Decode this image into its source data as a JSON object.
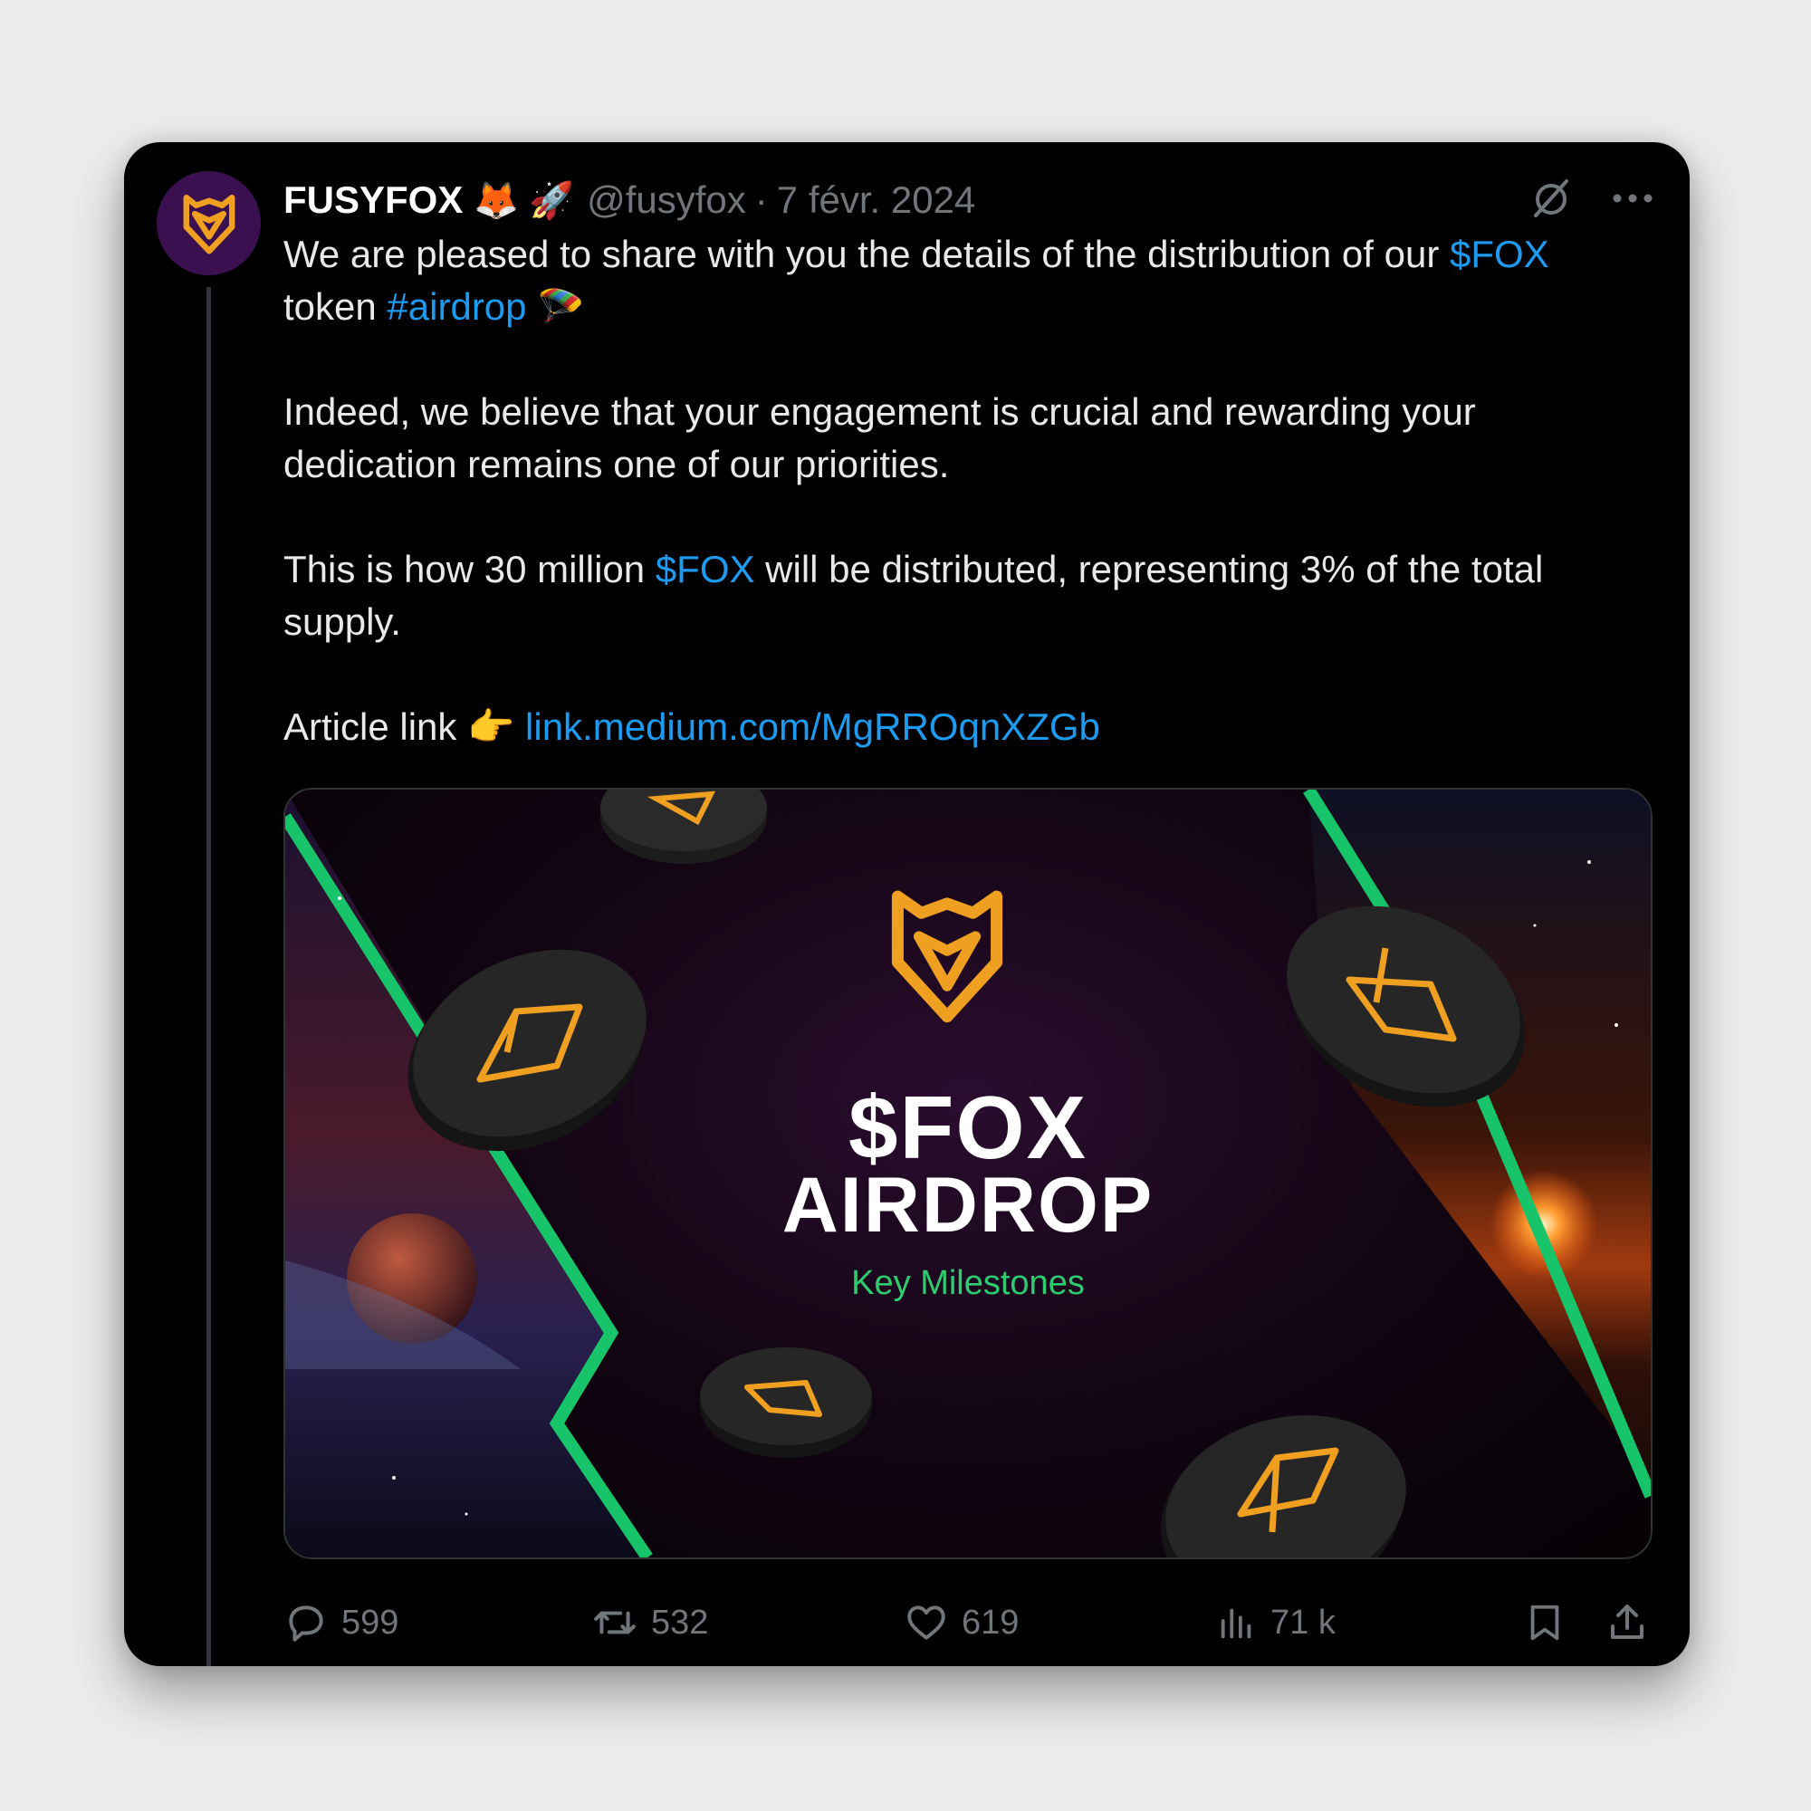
{
  "tweet": {
    "display_name": "FUSYFOX",
    "name_emojis": "🦊 🚀",
    "handle": "@fusyfox",
    "separator": "·",
    "date": "7 févr. 2024",
    "paragraph1_a": "We are pleased to share with you the details of the distribution of our ",
    "paragraph1_cashtag": "$FOX",
    "paragraph1_b": " token ",
    "paragraph1_hashtag": "#airdrop",
    "paragraph1_emoji": "🪂",
    "paragraph2": "Indeed, we believe that your engagement is crucial and rewarding your dedication remains one of our priorities.",
    "paragraph3_a": "This is how 30 million ",
    "paragraph3_cashtag": "$FOX",
    "paragraph3_b": " will be distributed, representing 3% of the total supply.",
    "article_label": "Article link ",
    "article_emoji": "👉",
    "article_url": "link.medium.com/MgRROqnXZGb"
  },
  "media": {
    "token": "$FOX",
    "title": "AIRDROP",
    "subtitle": "Key Milestones"
  },
  "actions": {
    "replies": "599",
    "reposts": "532",
    "likes": "619",
    "views": "71 k"
  },
  "colors": {
    "background": "#000000",
    "link": "#1d9bf0",
    "muted": "#71767b",
    "accent_green": "#2ecc71",
    "fox_orange": "#f0a020",
    "avatar_bg": "#3a1050"
  },
  "icons": [
    "fox-logo-icon",
    "grok-icon",
    "more-icon",
    "reply-icon",
    "repost-icon",
    "like-icon",
    "views-icon",
    "bookmark-icon",
    "share-icon"
  ]
}
